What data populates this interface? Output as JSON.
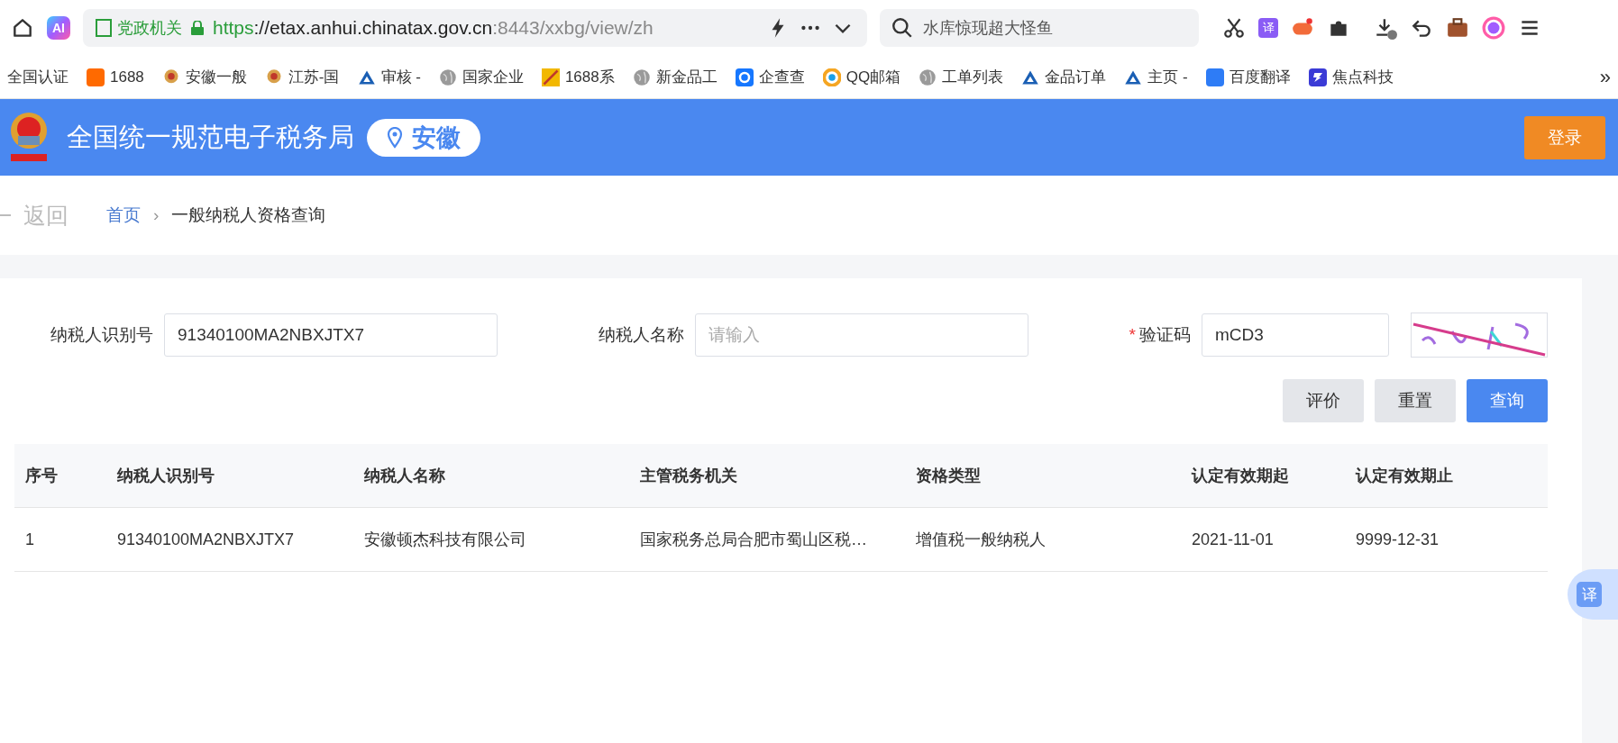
{
  "browser": {
    "ai_badge": "AI",
    "site_tag": "党政机关",
    "url_scheme": "https",
    "url_host": "://etax.anhui.chinatax.gov.cn",
    "url_rest": ":8443/xxbg/view/zh",
    "search": "水库惊现超大怪鱼",
    "translate_icon": "译",
    "bookmarks": [
      {
        "label": "全国认证",
        "kind": "none"
      },
      {
        "label": "1688",
        "kind": "ali"
      },
      {
        "label": "安徽一般",
        "kind": "emblem"
      },
      {
        "label": "江苏-国",
        "kind": "emblem"
      },
      {
        "label": "审核 -",
        "kind": "triangle"
      },
      {
        "label": "国家企业",
        "kind": "globe"
      },
      {
        "label": "1688系",
        "kind": "flag"
      },
      {
        "label": "新金品工",
        "kind": "globe"
      },
      {
        "label": "企查查",
        "kind": "qcc"
      },
      {
        "label": "QQ邮箱",
        "kind": "qq"
      },
      {
        "label": "工单列表",
        "kind": "globe"
      },
      {
        "label": "金品订单",
        "kind": "triangle"
      },
      {
        "label": "主页 -",
        "kind": "triangle"
      },
      {
        "label": "百度翻译",
        "kind": "fanyi"
      },
      {
        "label": "焦点科技",
        "kind": "focus"
      }
    ],
    "more": "»"
  },
  "header": {
    "title": "全国统一规范电子税务局",
    "region": "安徽",
    "login": "登录"
  },
  "breadcrumb": {
    "back": "返回",
    "home": "首页",
    "separator": "›",
    "current": "一般纳税人资格查询"
  },
  "form": {
    "fields": [
      {
        "label": "纳税人识别号",
        "value": "91340100MA2NBXJTX7",
        "required": false
      },
      {
        "label": "纳税人名称",
        "placeholder": "请输入",
        "required": false
      },
      {
        "label": "验证码",
        "value": "mCD3",
        "required": true
      }
    ],
    "required_mark": "*",
    "buttons": [
      {
        "label": "评价",
        "kind": "plain"
      },
      {
        "label": "重置",
        "kind": "plain"
      },
      {
        "label": "查询",
        "kind": "primary"
      }
    ]
  },
  "table": {
    "columns": [
      "序号",
      "纳税人识别号",
      "纳税人名称",
      "主管税务机关",
      "资格类型",
      "认定有效期起",
      "认定有效期止"
    ],
    "rows": [
      [
        "1",
        "91340100MA2NBXJTX7",
        "安徽顿杰科技有限公司",
        "国家税务总局合肥市蜀山区税…",
        "增值税一般纳税人",
        "2021-11-01",
        "9999-12-31"
      ]
    ]
  },
  "float_translate": "译"
}
